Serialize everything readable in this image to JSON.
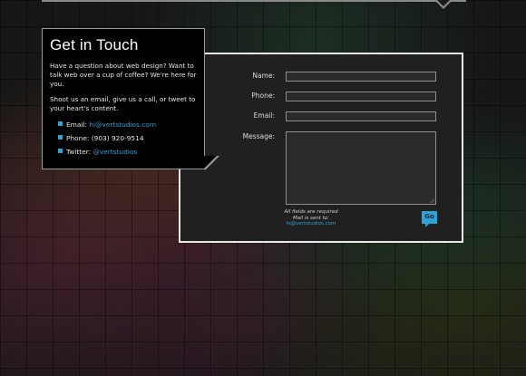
{
  "info": {
    "title": "Get in Touch",
    "intro": "Have a question about web design? Want to talk web over a cup of coffee? We're here for you.",
    "shoot": "Shoot us an email, give us a call, or tweet to your heart's content.",
    "contacts": [
      {
        "label": "Email: ",
        "value": "hi@vertstudios.com",
        "is_link": true
      },
      {
        "label": "Phone: ",
        "value": "(903) 920-9514",
        "is_link": false
      },
      {
        "label": "Twitter: ",
        "value": "@vertstudios",
        "is_link": true
      }
    ]
  },
  "form": {
    "name_label": "Name:",
    "phone_label": "Phone:",
    "email_label": "Email:",
    "message_label": "Message:",
    "note_required": "All fields are required",
    "note_sent": "Mail is sent to:",
    "note_email": "hi@vertstudios.com",
    "submit_label": "Go"
  },
  "colors": {
    "accent": "#2aa3d6",
    "panel_border": "#e8e8e8",
    "card_bg": "#000000"
  }
}
